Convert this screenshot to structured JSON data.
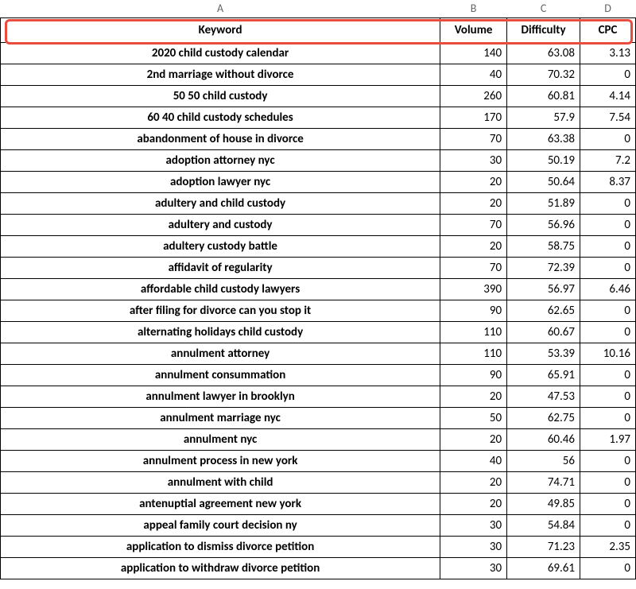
{
  "columns": {
    "letters": [
      "A",
      "B",
      "C",
      "D"
    ],
    "headers": [
      "Keyword",
      "Volume",
      "Difficulty",
      "CPC"
    ]
  },
  "rows": [
    {
      "keyword": "2020 child custody calendar",
      "volume": "140",
      "difficulty": "63.08",
      "cpc": "3.13"
    },
    {
      "keyword": "2nd marriage without divorce",
      "volume": "40",
      "difficulty": "70.32",
      "cpc": "0"
    },
    {
      "keyword": "50 50 child custody",
      "volume": "260",
      "difficulty": "60.81",
      "cpc": "4.14"
    },
    {
      "keyword": "60 40 child custody schedules",
      "volume": "170",
      "difficulty": "57.9",
      "cpc": "7.54"
    },
    {
      "keyword": "abandonment of house in divorce",
      "volume": "70",
      "difficulty": "63.38",
      "cpc": "0"
    },
    {
      "keyword": "adoption attorney nyc",
      "volume": "30",
      "difficulty": "50.19",
      "cpc": "7.2"
    },
    {
      "keyword": "adoption lawyer nyc",
      "volume": "20",
      "difficulty": "50.64",
      "cpc": "8.37"
    },
    {
      "keyword": "adultery and child custody",
      "volume": "20",
      "difficulty": "51.89",
      "cpc": "0"
    },
    {
      "keyword": "adultery and custody",
      "volume": "70",
      "difficulty": "56.96",
      "cpc": "0"
    },
    {
      "keyword": "adultery custody battle",
      "volume": "20",
      "difficulty": "58.75",
      "cpc": "0"
    },
    {
      "keyword": "affidavit of regularity",
      "volume": "70",
      "difficulty": "72.39",
      "cpc": "0"
    },
    {
      "keyword": "affordable child custody lawyers",
      "volume": "390",
      "difficulty": "56.97",
      "cpc": "6.46"
    },
    {
      "keyword": "after filing for divorce can you stop it",
      "volume": "90",
      "difficulty": "62.65",
      "cpc": "0"
    },
    {
      "keyword": "alternating holidays child custody",
      "volume": "110",
      "difficulty": "60.67",
      "cpc": "0"
    },
    {
      "keyword": "annulment attorney",
      "volume": "110",
      "difficulty": "53.39",
      "cpc": "10.16"
    },
    {
      "keyword": "annulment consummation",
      "volume": "90",
      "difficulty": "65.91",
      "cpc": "0"
    },
    {
      "keyword": "annulment lawyer in brooklyn",
      "volume": "20",
      "difficulty": "47.53",
      "cpc": "0"
    },
    {
      "keyword": "annulment marriage nyc",
      "volume": "50",
      "difficulty": "62.75",
      "cpc": "0"
    },
    {
      "keyword": "annulment nyc",
      "volume": "20",
      "difficulty": "60.46",
      "cpc": "1.97"
    },
    {
      "keyword": "annulment process in new york",
      "volume": "40",
      "difficulty": "56",
      "cpc": "0"
    },
    {
      "keyword": "annulment with child",
      "volume": "20",
      "difficulty": "74.71",
      "cpc": "0"
    },
    {
      "keyword": "antenuptial agreement new york",
      "volume": "20",
      "difficulty": "49.85",
      "cpc": "0"
    },
    {
      "keyword": "appeal family court decision ny",
      "volume": "30",
      "difficulty": "54.84",
      "cpc": "0"
    },
    {
      "keyword": "application to dismiss divorce petition",
      "volume": "30",
      "difficulty": "71.23",
      "cpc": "2.35"
    },
    {
      "keyword": "application to withdraw divorce petition",
      "volume": "30",
      "difficulty": "69.61",
      "cpc": "0"
    }
  ]
}
